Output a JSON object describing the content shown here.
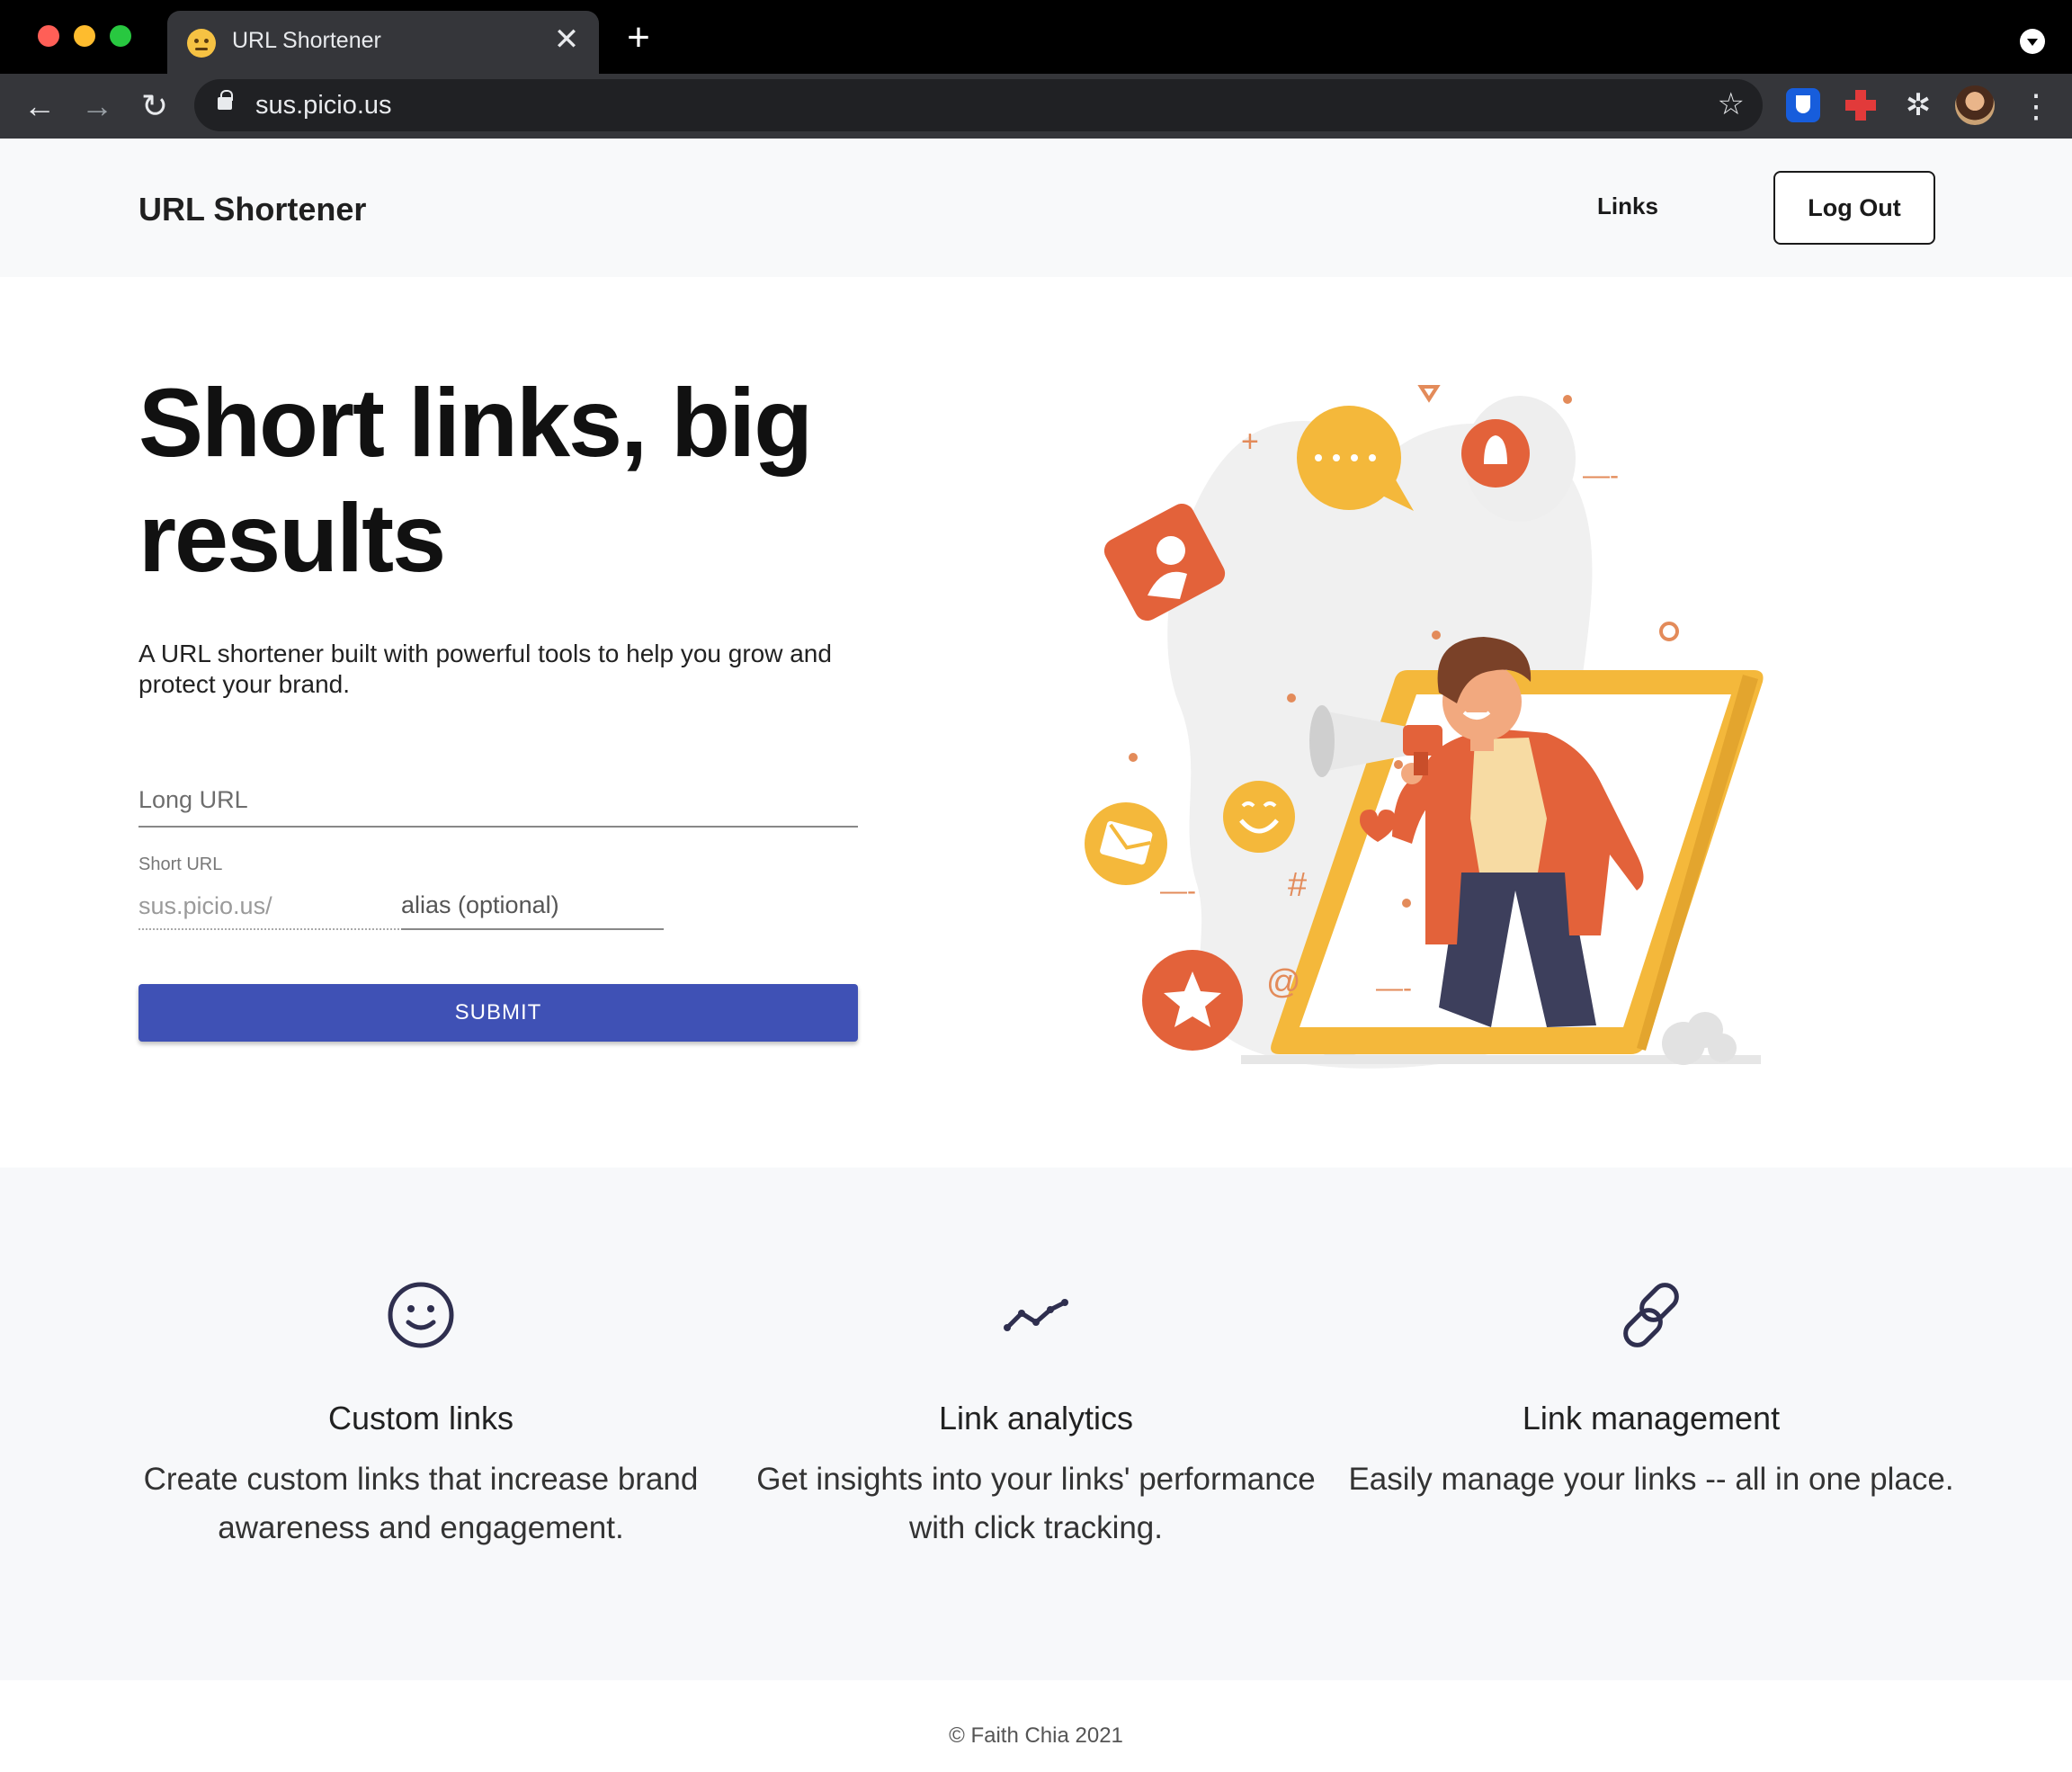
{
  "browser": {
    "tab_title": "URL Shortener",
    "tab_close": "✕",
    "new_tab": "+",
    "url": "sus.picio.us",
    "icons": {
      "back": "←",
      "forward": "→",
      "reload": "↻",
      "bookmark": "☆",
      "extensions": "✲",
      "menu": "⋮"
    }
  },
  "header": {
    "brand": "URL Shortener",
    "links": "Links",
    "logout": "Log Out"
  },
  "hero": {
    "title": "Short links, big results",
    "subtitle": "A URL shortener built with powerful tools to help you grow and protect your brand."
  },
  "form": {
    "long_url_placeholder": "Long URL",
    "short_url_label": "Short URL",
    "short_prefix": "sus.picio.us/",
    "alias_placeholder": "alias (optional)",
    "submit": "SUBMIT"
  },
  "features": [
    {
      "icon": "smiley-icon",
      "title": "Custom links",
      "description": "Create custom links that increase brand awareness and engagement."
    },
    {
      "icon": "analytics-line-icon",
      "title": "Link analytics",
      "description": "Get insights into your links' performance with click tracking."
    },
    {
      "icon": "link-icon",
      "title": "Link management",
      "description": "Easily manage your links -- all in one place."
    }
  ],
  "footer": {
    "copyright": "© Faith Chia 2021"
  },
  "colors": {
    "accent": "#3f51b5",
    "illustration_orange": "#e3623a",
    "illustration_yellow": "#f4b83b"
  }
}
